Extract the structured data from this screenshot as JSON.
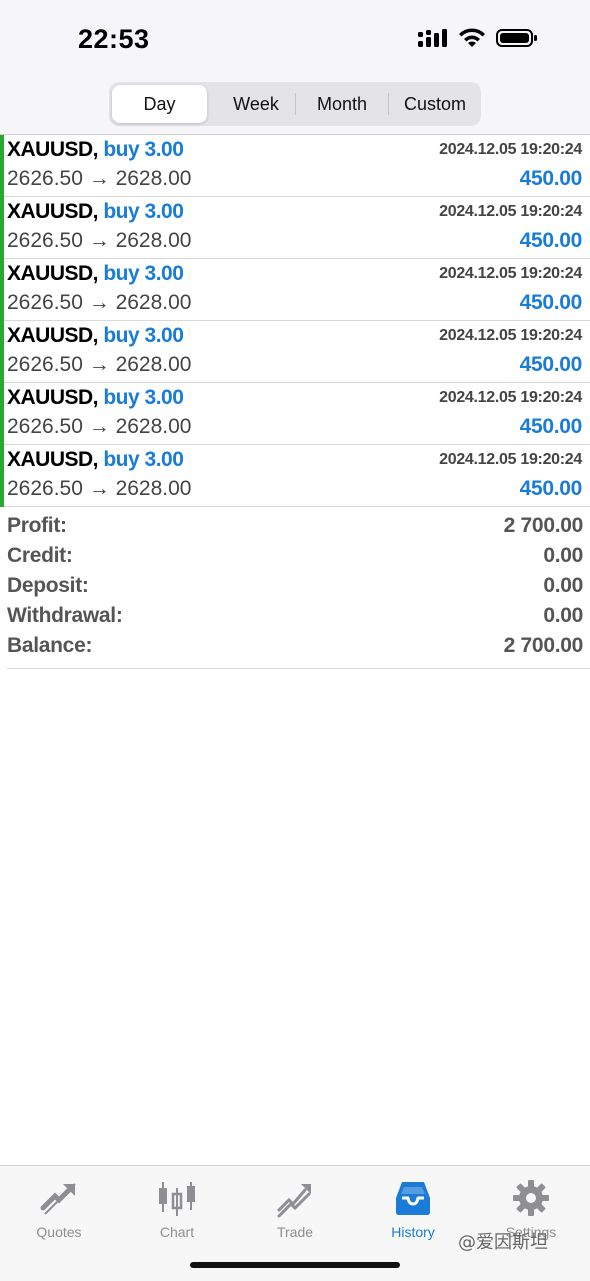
{
  "status_bar": {
    "time": "22:53"
  },
  "period_tabs": [
    {
      "label": "Day",
      "selected": true
    },
    {
      "label": "Week",
      "selected": false
    },
    {
      "label": "Month",
      "selected": false
    },
    {
      "label": "Custom",
      "selected": false
    }
  ],
  "deals": [
    {
      "symbol": "XAUUSD,",
      "side": "buy 3.00",
      "time": "2024.12.05 19:20:24",
      "prices": "2626.50 → 2628.00",
      "profit": "450.00"
    },
    {
      "symbol": "XAUUSD,",
      "side": "buy 3.00",
      "time": "2024.12.05 19:20:24",
      "prices": "2626.50 → 2628.00",
      "profit": "450.00"
    },
    {
      "symbol": "XAUUSD,",
      "side": "buy 3.00",
      "time": "2024.12.05 19:20:24",
      "prices": "2626.50 → 2628.00",
      "profit": "450.00"
    },
    {
      "symbol": "XAUUSD,",
      "side": "buy 3.00",
      "time": "2024.12.05 19:20:24",
      "prices": "2626.50 → 2628.00",
      "profit": "450.00"
    },
    {
      "symbol": "XAUUSD,",
      "side": "buy 3.00",
      "time": "2024.12.05 19:20:24",
      "prices": "2626.50 → 2628.00",
      "profit": "450.00"
    },
    {
      "symbol": "XAUUSD,",
      "side": "buy 3.00",
      "time": "2024.12.05 19:20:24",
      "prices": "2626.50 → 2628.00",
      "profit": "450.00"
    }
  ],
  "summary": [
    {
      "label": "Profit:",
      "value": "2 700.00"
    },
    {
      "label": "Credit:",
      "value": "0.00"
    },
    {
      "label": "Deposit:",
      "value": "0.00"
    },
    {
      "label": "Withdrawal:",
      "value": "0.00"
    },
    {
      "label": "Balance:",
      "value": "2 700.00"
    }
  ],
  "tab_bar": [
    {
      "label": "Quotes",
      "icon": "quotes-icon",
      "active": false
    },
    {
      "label": "Chart",
      "icon": "chart-icon",
      "active": false
    },
    {
      "label": "Trade",
      "icon": "trade-icon",
      "active": false
    },
    {
      "label": "History",
      "icon": "history-icon",
      "active": true
    },
    {
      "label": "Settings",
      "icon": "gear-icon",
      "active": false
    }
  ],
  "watermark": "@爱因斯坦",
  "colors": {
    "accent_blue": "#1a7cd6",
    "buy_green": "#2aa832",
    "inactive_gray": "#8e8e93"
  }
}
